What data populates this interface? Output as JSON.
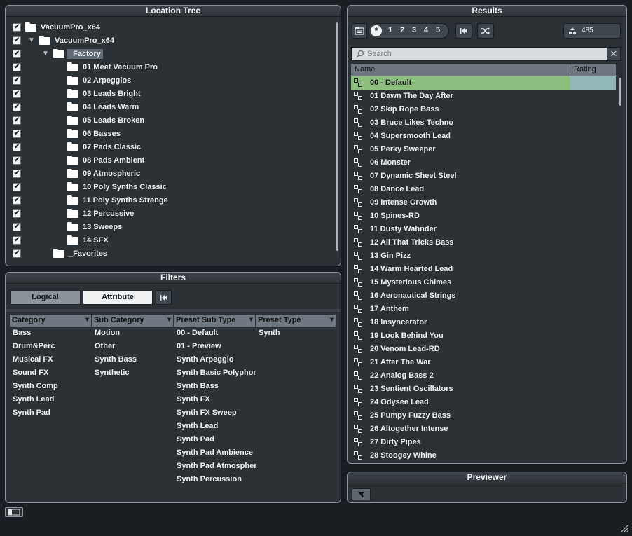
{
  "location_tree": {
    "title": "Location Tree",
    "rows": [
      {
        "label": "VacuumPro_x64",
        "checked": true,
        "indent": 0,
        "expanded": null,
        "selected": false
      },
      {
        "label": "VacuumPro_x64",
        "checked": true,
        "indent": 1,
        "expanded": true,
        "selected": false
      },
      {
        "label": "_Factory",
        "checked": true,
        "indent": 2,
        "expanded": true,
        "selected": true
      },
      {
        "label": "01 Meet Vacuum Pro",
        "checked": true,
        "indent": 3,
        "expanded": null,
        "selected": false
      },
      {
        "label": "02 Arpeggios",
        "checked": true,
        "indent": 3,
        "expanded": null,
        "selected": false
      },
      {
        "label": "03 Leads Bright",
        "checked": true,
        "indent": 3,
        "expanded": null,
        "selected": false
      },
      {
        "label": "04 Leads Warm",
        "checked": true,
        "indent": 3,
        "expanded": null,
        "selected": false
      },
      {
        "label": "05 Leads Broken",
        "checked": true,
        "indent": 3,
        "expanded": null,
        "selected": false
      },
      {
        "label": "06 Basses",
        "checked": true,
        "indent": 3,
        "expanded": null,
        "selected": false
      },
      {
        "label": "07 Pads Classic",
        "checked": true,
        "indent": 3,
        "expanded": null,
        "selected": false
      },
      {
        "label": "08 Pads Ambient",
        "checked": true,
        "indent": 3,
        "expanded": null,
        "selected": false
      },
      {
        "label": "09 Atmospheric",
        "checked": true,
        "indent": 3,
        "expanded": null,
        "selected": false
      },
      {
        "label": "10 Poly Synths Classic",
        "checked": true,
        "indent": 3,
        "expanded": null,
        "selected": false
      },
      {
        "label": "11 Poly Synths Strange",
        "checked": true,
        "indent": 3,
        "expanded": null,
        "selected": false
      },
      {
        "label": "12 Percussive",
        "checked": true,
        "indent": 3,
        "expanded": null,
        "selected": false
      },
      {
        "label": "13 Sweeps",
        "checked": true,
        "indent": 3,
        "expanded": null,
        "selected": false
      },
      {
        "label": "14 SFX",
        "checked": true,
        "indent": 3,
        "expanded": null,
        "selected": false
      },
      {
        "label": "_Favorites",
        "checked": true,
        "indent": 2,
        "expanded": null,
        "selected": false
      }
    ]
  },
  "filters": {
    "title": "Filters",
    "logical_label": "Logical",
    "attribute_label": "Attribute",
    "reset_icon": "skip-back-icon",
    "columns": [
      {
        "header": "Category",
        "items": [
          "Bass",
          "Drum&Perc",
          "Musical FX",
          "Sound FX",
          "Synth Comp",
          "Synth Lead",
          "Synth Pad"
        ]
      },
      {
        "header": "Sub Category",
        "items": [
          "Motion",
          "Other",
          "Synth Bass",
          "Synthetic"
        ]
      },
      {
        "header": "Preset Sub Type",
        "items": [
          "00 - Default",
          "01 - Preview",
          "Synth Arpeggio",
          "Synth Basic Polyphon",
          "Synth Bass",
          "Synth FX",
          "Synth FX Sweep",
          "Synth Lead",
          "Synth Pad",
          "Synth Pad Ambience",
          "Synth Pad Atmospher",
          "Synth Percussion"
        ]
      },
      {
        "header": "Preset Type",
        "items": [
          "Synth"
        ]
      }
    ]
  },
  "results": {
    "title": "Results",
    "toolbar": {
      "browse_icon": "folder-browse-icon",
      "rating_all": "*",
      "ratings": [
        "1",
        "2",
        "3",
        "4",
        "5"
      ],
      "reset_icon": "skip-back-icon",
      "shuffle_icon": "shuffle-icon",
      "count": "485"
    },
    "search_placeholder": "Search",
    "col_name": "Name",
    "col_rating": "Rating",
    "items": [
      "00 - Default",
      "01 Dawn The Day After",
      "02 Skip Rope Bass",
      "03 Bruce Likes Techno",
      "04 Supersmooth Lead",
      "05 Perky Sweeper",
      "06 Monster",
      "07 Dynamic Sheet Steel",
      "08 Dance Lead",
      "09 Intense Growth",
      "10 Spines-RD",
      "11 Dusty Wahnder",
      "12 All That Tricks Bass",
      "13 Gin Pizz",
      "14 Warm Hearted Lead",
      "15 Mysterious Chimes",
      "16 Aeronautical Strings",
      "17 Anthem",
      "18 Insyncerator",
      "19 Look Behind You",
      "20 Venom Lead-RD",
      "21 After The War",
      "22 Analog Bass 2",
      "23 Sentient Oscillators",
      "24 Odysee Lead",
      "25 Pumpy Fuzzy Bass",
      "26 Altogether Intense",
      "27 Dirty Pipes",
      "28 Stoogey Whine"
    ],
    "selected_index": 0,
    "colors": {
      "selected_name": "#8bbf7d",
      "selected_rating": "#8fb7b6"
    }
  },
  "previewer": {
    "title": "Previewer"
  }
}
